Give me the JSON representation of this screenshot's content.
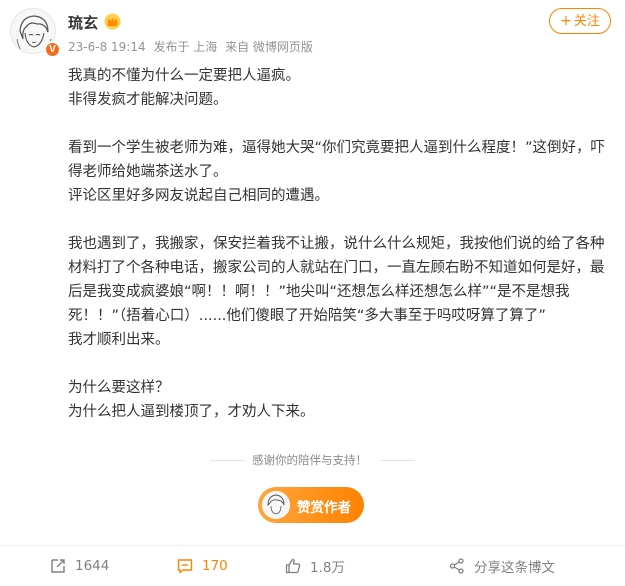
{
  "user": {
    "name": "琉玄",
    "verified_badge": "V",
    "crown_icon": "crown-icon"
  },
  "meta": {
    "date": "23-6-8 19:14",
    "location": "发布于 上海",
    "source": "来自 微博网页版"
  },
  "follow_label": "关注",
  "post": {
    "lines": [
      "我真的不懂为什么一定要把人逼疯。",
      "非得发疯才能解决问题。",
      "",
      "看到一个学生被老师为难，逼得她大哭“你们究竟要把人逼到什么程度！”这倒好，吓得老师给她端茶送水了。",
      "评论区里好多网友说起自己相同的遭遇。",
      "",
      "我也遇到了，我搬家，保安拦着我不让搬，说什么什么规矩，我按他们说的给了各种材料打了个各种电话，搬家公司的人就站在门口，一直左顾右盼不知道如何是好，最后是我变成疯婆娘“啊！！啊！！”地尖叫“还想怎么样还想怎么样”“是不是想我死！！”（捂着心口）......他们傻眼了开始陪笑“多大事至于吗哎呀算了算了”",
      "我才顺利出来。",
      "",
      "为什么要这样？",
      "为什么把人逼到楼顶了，才劝人下来。"
    ]
  },
  "thanks_text": "感谢你的陪伴与支持！",
  "reward_label": "赞赏作者",
  "actions": {
    "repost_count": "1644",
    "comment_count": "170",
    "like_count": "1.8万",
    "share_label": "分享这条博文"
  },
  "colors": {
    "accent": "#ff8200",
    "muted": "#939393",
    "text": "#333333"
  }
}
